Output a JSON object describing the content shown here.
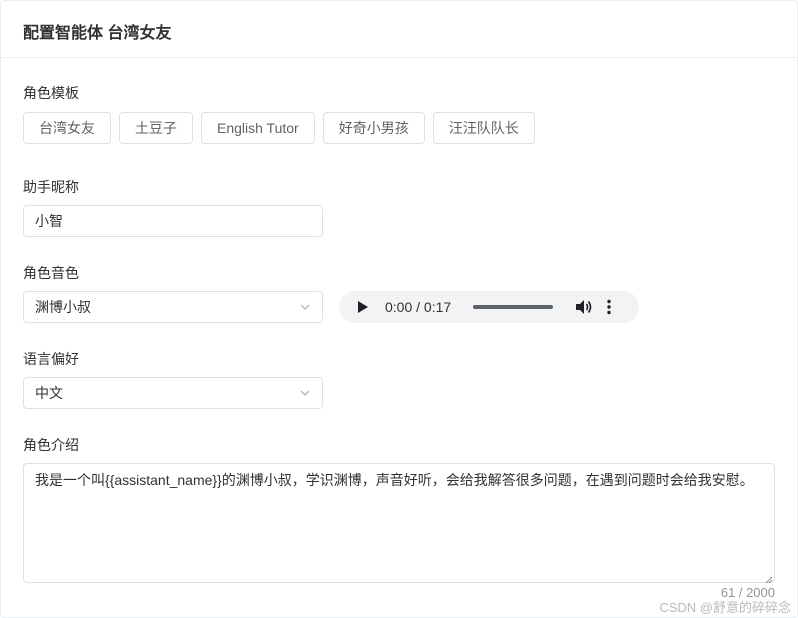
{
  "header": {
    "title": "配置智能体 台湾女友"
  },
  "role_template": {
    "label": "角色模板",
    "options": [
      "台湾女友",
      "土豆子",
      "English Tutor",
      "好奇小男孩",
      "汪汪队队长"
    ]
  },
  "assistant_name": {
    "label": "助手昵称",
    "value": "小智"
  },
  "voice": {
    "label": "角色音色",
    "selected": "渊博小叔",
    "audio": {
      "current_time": "0:00",
      "duration": "0:17"
    }
  },
  "language": {
    "label": "语言偏好",
    "selected": "中文"
  },
  "intro": {
    "label": "角色介绍",
    "value": "我是一个叫{{assistant_name}}的渊博小叔，学识渊博，声音好听，会给我解答很多问题，在遇到问题时会给我安慰。",
    "counter": "61 / 2000"
  },
  "watermark": "CSDN @舒意的碎碎念",
  "colors": {
    "border": "#dcdfe6",
    "text": "#303133",
    "muted": "#909399",
    "audio_bg": "#f1f3f4"
  }
}
